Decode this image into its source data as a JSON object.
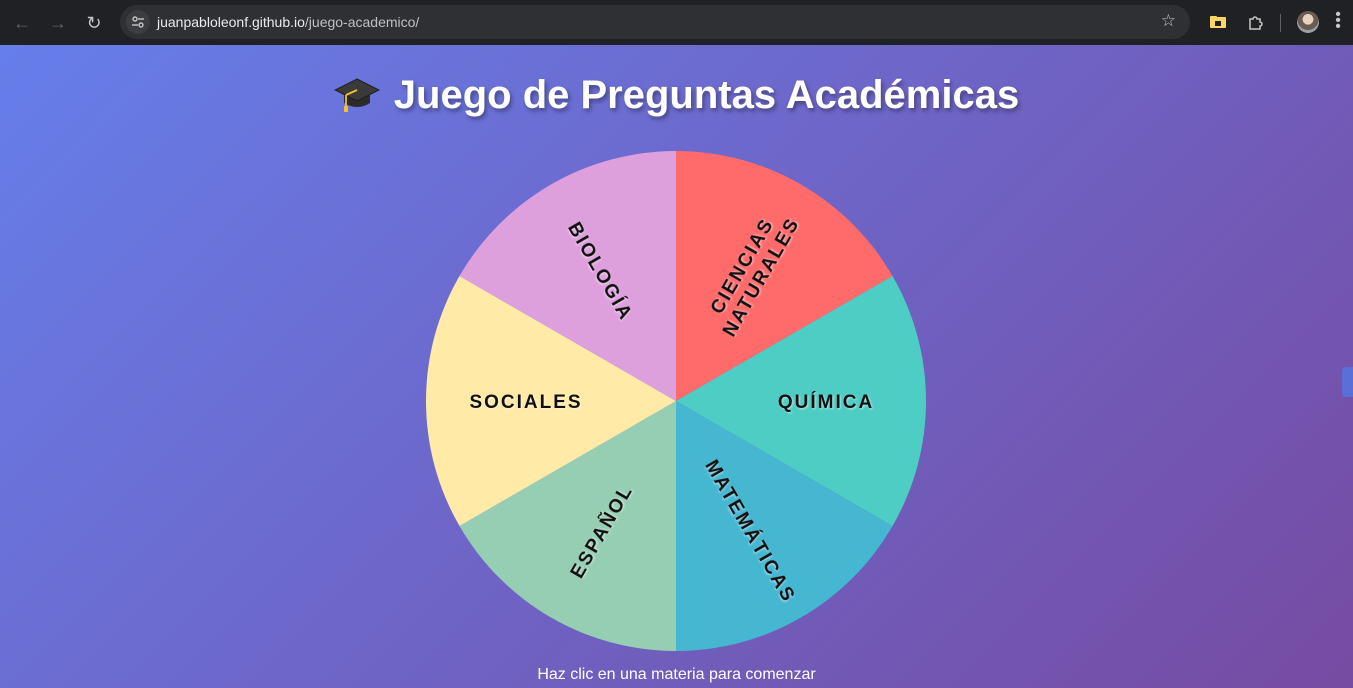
{
  "browser": {
    "url_host": "juanpabloleonf.github.io",
    "url_path": "/juego-academico/"
  },
  "page": {
    "title": "Juego de Preguntas Académicas",
    "title_icon": "graduation-cap-icon",
    "hint": "Haz clic en una materia para comenzar"
  },
  "wheel": {
    "segments": [
      {
        "name": "ciencias-naturales",
        "lines": [
          "CIENCIAS",
          "NATURALES"
        ],
        "color": "#ff6b6b"
      },
      {
        "name": "quimica",
        "lines": [
          "QUÍMICA"
        ],
        "color": "#4ecdc4"
      },
      {
        "name": "matematicas",
        "lines": [
          "MATEMÁTICAS"
        ],
        "color": "#45b7d1"
      },
      {
        "name": "espanol",
        "lines": [
          "ESPAÑOL"
        ],
        "color": "#96ceb4"
      },
      {
        "name": "sociales",
        "lines": [
          "SOCIALES"
        ],
        "color": "#ffeaa7"
      },
      {
        "name": "biologia",
        "lines": [
          "BIOLOGÍA"
        ],
        "color": "#dda0dd"
      }
    ]
  }
}
